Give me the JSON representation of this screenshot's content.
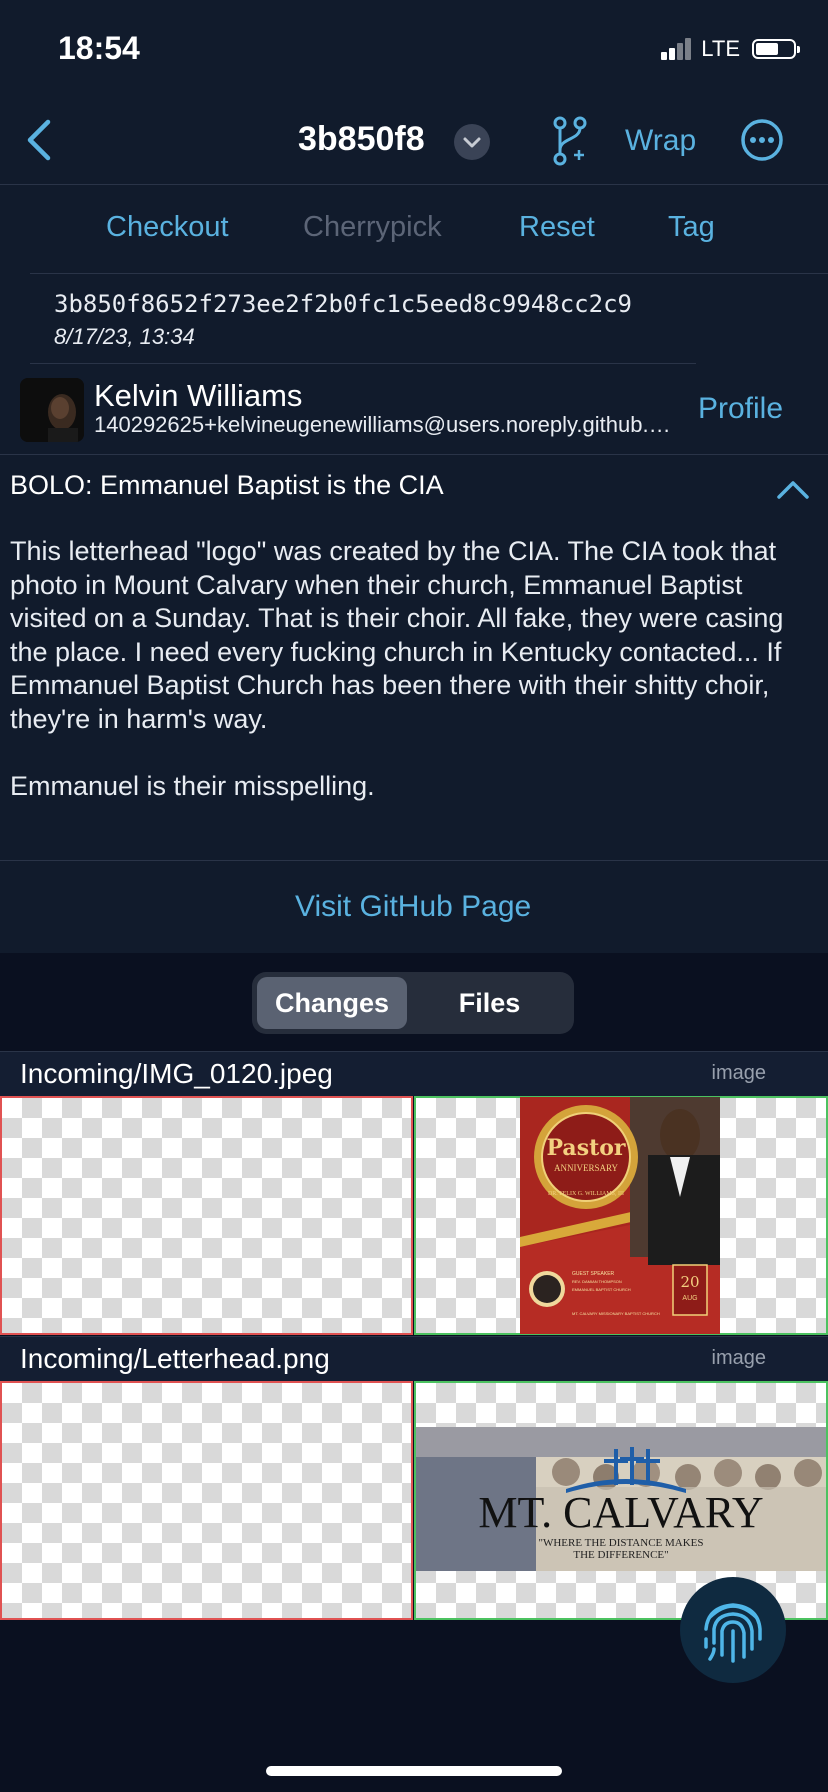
{
  "status": {
    "time": "18:54",
    "network": "LTE"
  },
  "nav": {
    "title": "3b850f8",
    "wrap_label": "Wrap"
  },
  "actions": {
    "checkout": "Checkout",
    "cherrypick": "Cherrypick",
    "reset": "Reset",
    "tag": "Tag"
  },
  "commit": {
    "hash": "3b850f8652f273ee2f2b0fc1c5eed8c9948cc2c9",
    "date": "8/17/23, 13:34",
    "author_name": "Kelvin Williams",
    "author_email": "140292625+kelvineugenewilliams@users.noreply.github.com",
    "profile_label": "Profile",
    "subject": "BOLO: Emmanuel Baptist is the CIA",
    "body": [
      "This letterhead \"logo\" was created by the CIA.  The CIA took that photo in Mount Calvary when their church, Emmanuel Baptist visited on a Sunday.  That is their choir.  All fake, they were casing the place.  I need every fucking church in Kentucky contacted...  If Emmanuel Baptist Church has been there with their shitty choir, they're in harm's way.",
      "Emmanuel is their misspelling."
    ],
    "visit_label": "Visit GitHub Page"
  },
  "segment": {
    "changes": "Changes",
    "files": "Files",
    "selected": "Changes"
  },
  "files": [
    {
      "name": "Incoming/IMG_0120.jpeg",
      "type": "image",
      "flyer": {
        "title": "Pastor",
        "subtitle": "ANNIVERSARY",
        "honoree": "DR. FELIX G. WILLIAMS, III",
        "guest_label": "GUEST SPEAKER",
        "guest_name": "REV. DAMIAN THOMPSON",
        "guest_church": "EMMANUEL BAPTIST CHURCH",
        "host": "MT. CALVARY MISSIONARY BAPTIST CHURCH",
        "day": "20",
        "month": "AUG"
      }
    },
    {
      "name": "Incoming/Letterhead.png",
      "type": "image",
      "letterhead": {
        "title": "MT. CALVARY",
        "tagline_1": "\"WHERE THE DISTANCE MAKES",
        "tagline_2": "THE DIFFERENCE\""
      }
    }
  ],
  "colors": {
    "accent": "#5ab2e0",
    "background": "#111b2c",
    "deleted": "#e05252",
    "added": "#4cc260"
  }
}
